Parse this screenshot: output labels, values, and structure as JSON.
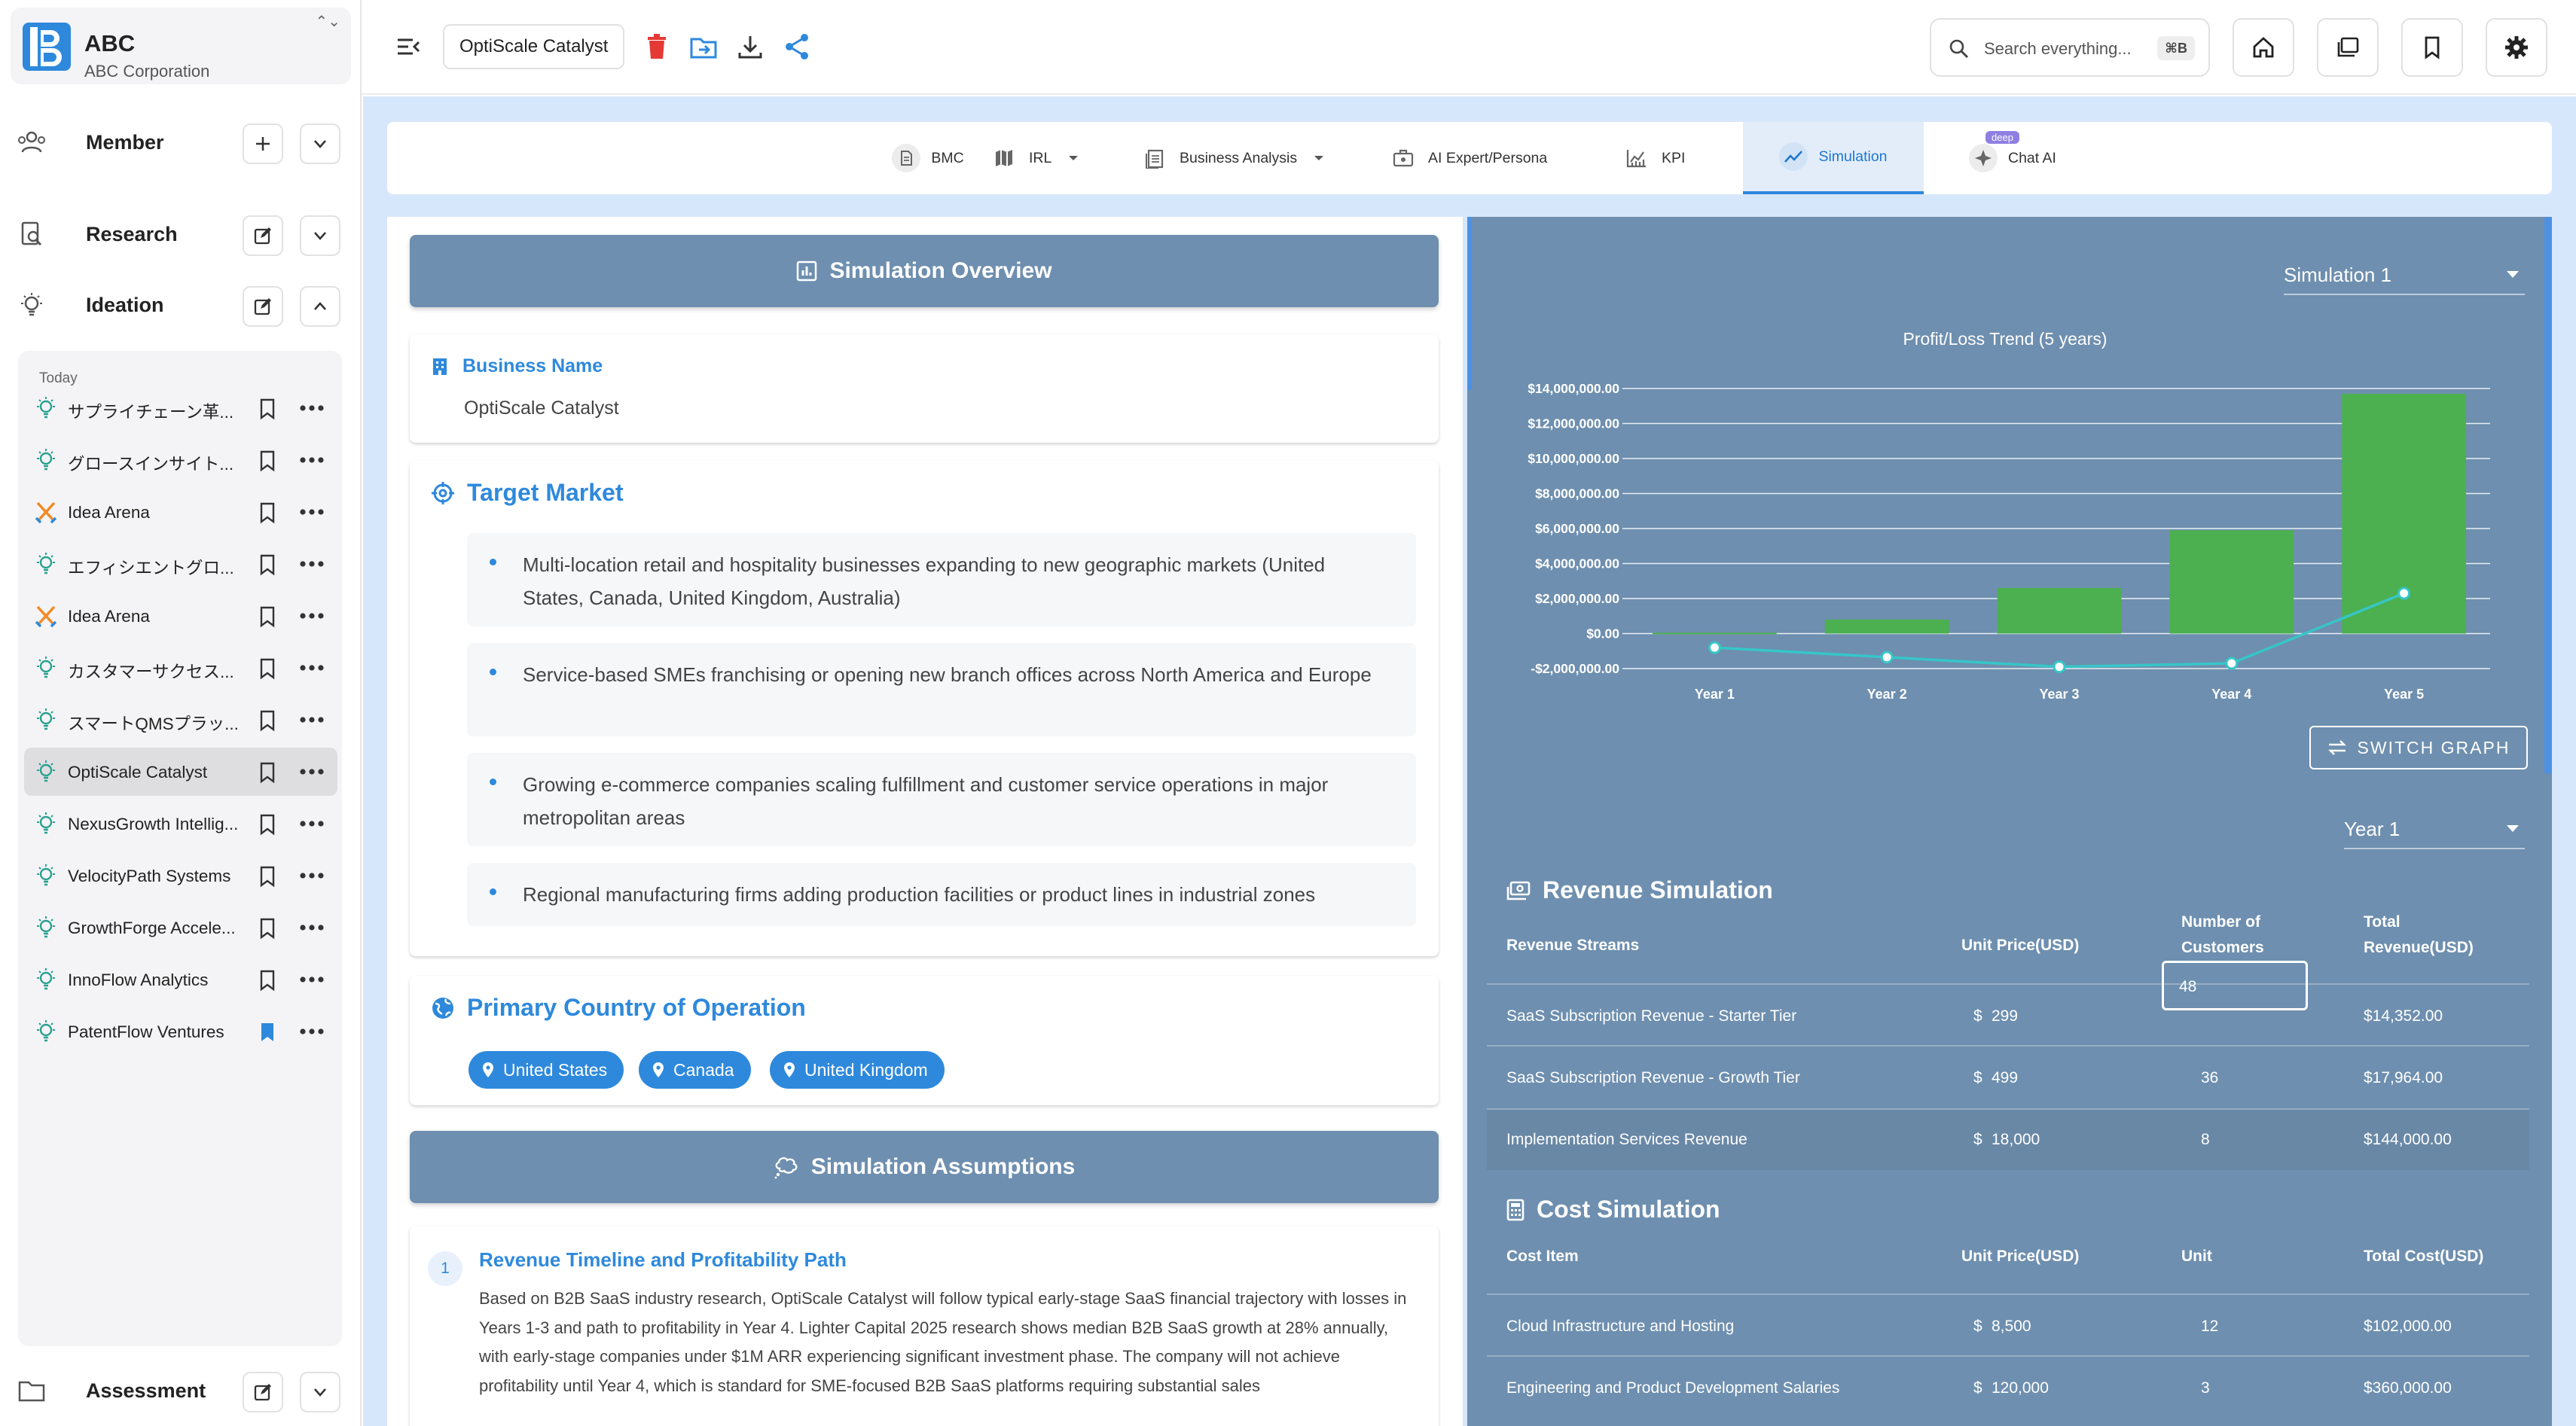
{
  "brand": {
    "name": "ABC",
    "company": "ABC Corporation",
    "toggle": "⌃⌄"
  },
  "sidebar": {
    "sections": {
      "member": "Member",
      "research": "Research",
      "ideation": "Ideation",
      "assessment": "Assessment"
    },
    "today_label": "Today",
    "ideas": [
      {
        "label": "サプライチェーン革...",
        "icon": "lightbulb-icon",
        "bookmarked": false
      },
      {
        "label": "グロースインサイト...",
        "icon": "lightbulb-icon",
        "bookmarked": false
      },
      {
        "label": "Idea Arena",
        "icon": "crossed-swords-icon",
        "bookmarked": false
      },
      {
        "label": "エフィシエントグロ...",
        "icon": "lightbulb-icon",
        "bookmarked": false
      },
      {
        "label": "Idea Arena",
        "icon": "crossed-swords-icon",
        "bookmarked": false
      },
      {
        "label": "カスタマーサクセス...",
        "icon": "lightbulb-icon",
        "bookmarked": false
      },
      {
        "label": "スマートQMSプラッ...",
        "icon": "lightbulb-icon",
        "bookmarked": false
      },
      {
        "label": "OptiScale Catalyst",
        "icon": "lightbulb-icon",
        "bookmarked": false,
        "selected": true
      },
      {
        "label": "NexusGrowth Intellig...",
        "icon": "lightbulb-icon",
        "bookmarked": false
      },
      {
        "label": "VelocityPath Systems",
        "icon": "lightbulb-icon",
        "bookmarked": false
      },
      {
        "label": "GrowthForge Accele...",
        "icon": "lightbulb-icon",
        "bookmarked": false
      },
      {
        "label": "InnoFlow Analytics",
        "icon": "lightbulb-icon",
        "bookmarked": false
      },
      {
        "label": "PatentFlow Ventures",
        "icon": "lightbulb-icon",
        "bookmarked": true
      }
    ]
  },
  "topbar": {
    "business_name": "OptiScale Catalyst",
    "search_placeholder": "Search everything...",
    "search_shortcut": "⌘B"
  },
  "tabs": [
    {
      "label": "BMC",
      "icon": "document-icon"
    },
    {
      "label": "IRL",
      "icon": "map-icon",
      "dropdown": true
    },
    {
      "label": "Business Analysis",
      "icon": "report-icon",
      "dropdown": true
    },
    {
      "label": "AI Expert/Persona",
      "icon": "briefcase-icon"
    },
    {
      "label": "KPI",
      "icon": "chart-icon"
    },
    {
      "label": "Simulation",
      "icon": "trend-icon",
      "active": true
    },
    {
      "label": "Chat AI",
      "icon": "sparkle-icon",
      "badge": "deep"
    }
  ],
  "overview": {
    "title": "Simulation Overview",
    "business_name_label": "Business Name",
    "business_name_value": "OptiScale Catalyst",
    "target_market_title": "Target Market",
    "target_market": [
      "Multi-location retail and hospitality businesses expanding to new geographic markets (United States, Canada, United Kingdom, Australia)",
      "Service-based SMEs franchising or opening new branch offices across North America and Europe",
      "Growing e-commerce companies scaling fulfillment and customer service operations in major metropolitan areas",
      "Regional manufacturing firms adding production facilities or product lines in industrial zones"
    ],
    "primary_country_title": "Primary Country of Operation",
    "countries": [
      "United States",
      "Canada",
      "United Kingdom"
    ]
  },
  "assumptions": {
    "title": "Simulation Assumptions",
    "items": [
      {
        "number": "1",
        "title": "Revenue Timeline and Profitability Path",
        "text": "Based on B2B SaaS industry research, OptiScale Catalyst will follow typical early-stage SaaS financial trajectory with losses in Years 1-3 and path to profitability in Year 4. Lighter Capital 2025 research shows median B2B SaaS growth at 28% annually, with early-stage companies under $1M ARR experiencing significant investment phase. The company will not achieve profitability until Year 4, which is standard for SME-focused B2B SaaS platforms requiring substantial sales"
      }
    ]
  },
  "simulation": {
    "selector": "Simulation 1",
    "switch_label": "SWITCH GRAPH",
    "year_selector": "Year 1",
    "revenue": {
      "title": "Revenue Simulation",
      "headers": [
        "Revenue Streams",
        "Unit Price(USD)",
        "Number of Customers",
        "Total Revenue(USD)"
      ],
      "rows": [
        {
          "stream": "SaaS Subscription Revenue - Starter Tier",
          "currency": "$",
          "price": "299",
          "customers": "48",
          "total": "$14,352.00"
        },
        {
          "stream": "SaaS Subscription Revenue - Growth Tier",
          "currency": "$",
          "price": "499",
          "customers": "36",
          "total": "$17,964.00"
        },
        {
          "stream": "Implementation Services Revenue",
          "currency": "$",
          "price": "18,000",
          "customers": "8",
          "total": "$144,000.00"
        }
      ]
    },
    "cost": {
      "title": "Cost Simulation",
      "headers": [
        "Cost Item",
        "Unit Price(USD)",
        "Unit",
        "Total Cost(USD)"
      ],
      "rows": [
        {
          "item": "Cloud Infrastructure and Hosting",
          "currency": "$",
          "price": "8,500",
          "unit": "12",
          "total": "$102,000.00"
        },
        {
          "item": "Engineering and Product Development Salaries",
          "currency": "$",
          "price": "120,000",
          "unit": "3",
          "total": "$360,000.00"
        }
      ]
    }
  },
  "colors": {
    "accent": "#2e89dc",
    "panel": "#6e8faf",
    "bar": "#4cb050",
    "line": "#36c6c8",
    "danger": "#e53935"
  },
  "chart_data": {
    "type": "bar",
    "title": "Profit/Loss Trend (5 years)",
    "categories": [
      "Year 1",
      "Year 2",
      "Year 3",
      "Year 4",
      "Year 5"
    ],
    "series": [
      {
        "type": "bar",
        "values": [
          50000,
          800000,
          2600000,
          5900000,
          13700000
        ]
      },
      {
        "type": "line",
        "values": [
          -800000,
          -1350000,
          -1900000,
          -1700000,
          2300000
        ]
      }
    ],
    "ylim": [
      -2000000,
      14000000
    ],
    "yticks": [
      14000000,
      12000000,
      10000000,
      8000000,
      6000000,
      4000000,
      2000000,
      0,
      -2000000
    ],
    "ytick_labels": [
      "$14,000,000.00",
      "$12,000,000.00",
      "$10,000,000.00",
      "$8,000,000.00",
      "$6,000,000.00",
      "$4,000,000.00",
      "$2,000,000.00",
      "$0.00",
      "-$2,000,000.00"
    ],
    "grid": true
  }
}
